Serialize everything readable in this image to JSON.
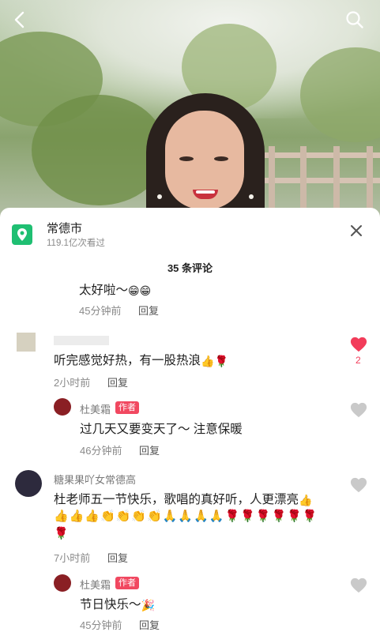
{
  "location": {
    "name": "常德市",
    "views": "119.1亿次看过"
  },
  "comment_count_label": "35 条评论",
  "comments": [
    {
      "id": "c0",
      "text": "太好啦～",
      "emoji": "😁😁",
      "time": "45分钟前",
      "reply_label": "回复"
    },
    {
      "id": "c1",
      "text": "听完感觉好热，有一股热浪",
      "emoji": "👍🌹",
      "time": "2小时前",
      "reply_label": "回复",
      "likes": "2",
      "liked": true
    },
    {
      "id": "c2",
      "user": "杜美霜",
      "tag": "作者",
      "text": "过几天又要变天了～ 注意保暖",
      "time": "46分钟前",
      "reply_label": "回复"
    },
    {
      "id": "c3",
      "user": "糖果果吖女常德高",
      "text": "杜老师五一节快乐，歌唱的真好听，人更漂亮",
      "emoji_inline": "👍",
      "emoji_line1": "👍👍👍👏👏👏👏🙏🙏🙏🙏🌹🌹🌹🌹🌹🌹",
      "emoji_line2": "🌹",
      "time": "7小时前",
      "reply_label": "回复"
    },
    {
      "id": "c4",
      "user": "杜美霜",
      "tag": "作者",
      "text": "节日快乐～",
      "emoji": "🎉",
      "time": "45分钟前",
      "reply_label": "回复"
    }
  ],
  "colors": {
    "accent": "#f14860",
    "like": "#f23c5a",
    "location": "#1fbf72"
  },
  "icons": {
    "back": "back-icon",
    "search": "search-icon",
    "close": "close-icon",
    "location": "location-pin-icon",
    "heart": "heart-icon"
  }
}
